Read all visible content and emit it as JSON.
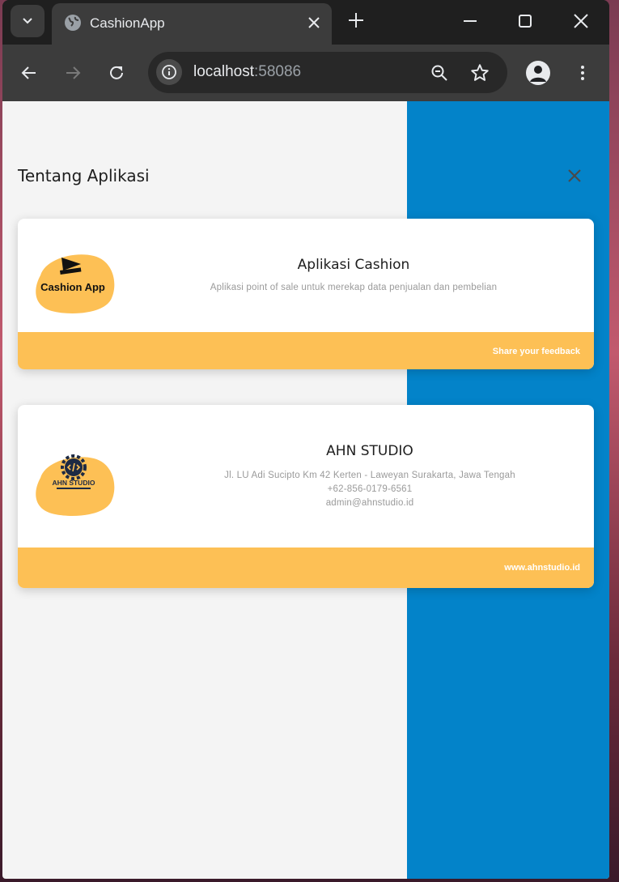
{
  "browser": {
    "tab_title": "CashionApp",
    "url_host": "localhost",
    "url_port": ":58086"
  },
  "page": {
    "title": "Tentang Aplikasi"
  },
  "app_card": {
    "logo_text": "Cashion App",
    "title": "Aplikasi Cashion",
    "description": "Aplikasi point of sale untuk merekap data penjualan dan pembelian",
    "footer_link": "Share your feedback"
  },
  "studio_card": {
    "logo_text": "AHN STUDIO",
    "title": "AHN STUDIO",
    "address": "Jl. LU Adi Sucipto Km 42 Kerten - Laweyan Surakarta, Jawa Tengah",
    "phone": "+62-856-0179-6561",
    "email": "admin@ahnstudio.id",
    "footer_link": "www.ahnstudio.id"
  },
  "colors": {
    "accent_yellow": "#fdc055",
    "blue_panel": "#0383c9",
    "chrome_dark": "#202124"
  },
  "icons": [
    "tab-dropdown-icon",
    "globe-icon",
    "close-icon",
    "new-tab-icon",
    "minimize-icon",
    "maximize-icon",
    "back-icon",
    "forward-icon",
    "reload-icon",
    "info-icon",
    "zoom-out-icon",
    "bookmark-star-icon",
    "profile-icon",
    "menu-icon"
  ]
}
